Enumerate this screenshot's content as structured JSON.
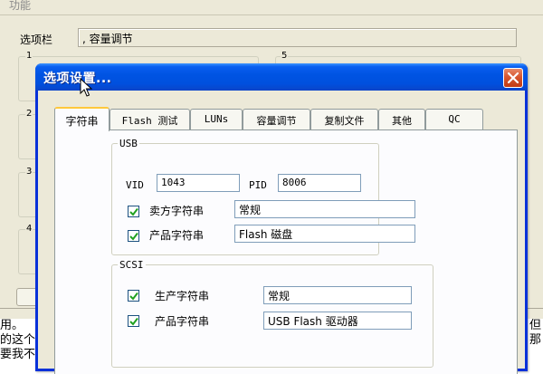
{
  "background_window": {
    "title": "功能",
    "option_bar_label": "选项栏",
    "option_bar_value": ", 容量调节",
    "groups": [
      {
        "number": "1"
      },
      {
        "number": "2"
      },
      {
        "number": "3"
      },
      {
        "number": "4"
      },
      {
        "number": "5"
      }
    ]
  },
  "background_text": {
    "line1_left": "用。",
    "line1_right": "但",
    "line2_left": "的这个",
    "line2_right": "那",
    "line3_left": "要我不"
  },
  "dialog": {
    "title": "选项设置...",
    "tabs": [
      {
        "label": "字符串"
      },
      {
        "label": "Flash 测试"
      },
      {
        "label": "LUNs"
      },
      {
        "label": "容量调节"
      },
      {
        "label": "复制文件"
      },
      {
        "label": "其他"
      },
      {
        "label": "QC"
      }
    ],
    "usb": {
      "legend": "USB",
      "vid_label": "VID",
      "vid_value": "1043",
      "pid_label": "PID",
      "pid_value": "8006",
      "vendor_label": "卖方字符串",
      "vendor_value": "常规",
      "vendor_checked": true,
      "product_label": "产品字符串",
      "product_value": "Flash 磁盘",
      "product_checked": true
    },
    "scsi": {
      "legend": "SCSI",
      "manufacturer_label": "生产字符串",
      "manufacturer_value": "常规",
      "manufacturer_checked": true,
      "product_label": "产品字符串",
      "product_value": "USB Flash 驱动器",
      "product_checked": true
    }
  },
  "colors": {
    "titlebar": "#0054e3",
    "close_button": "#d7562f",
    "window_face": "#ece9d8",
    "tab_highlight": "#ffc83c"
  }
}
